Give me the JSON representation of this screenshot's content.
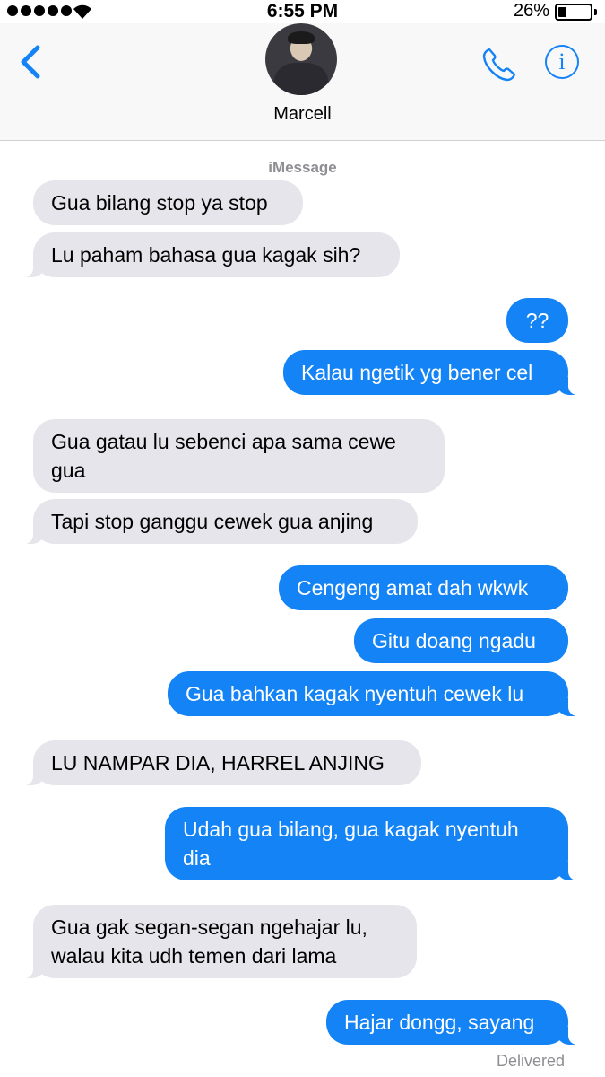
{
  "status_bar": {
    "time": "6:55 PM",
    "battery": "26%",
    "battery_level": 0.26,
    "signal_bars": 5,
    "icons": [
      "signal-dots",
      "wifi-icon",
      "battery-icon"
    ]
  },
  "header": {
    "contact_name": "Marcell",
    "icons": [
      "back-chevron-icon",
      "avatar",
      "phone-icon",
      "info-icon"
    ],
    "accent_color": "#1483f5"
  },
  "service_label": "iMessage",
  "colors": {
    "incoming_bubble": "#e6e5eb",
    "outgoing_bubble": "#1483f5",
    "meta_text": "#8e8e93"
  },
  "messages": [
    {
      "from": "contact",
      "text": "Gua bilang stop ya stop"
    },
    {
      "from": "contact",
      "text": "Lu paham bahasa gua kagak sih?"
    },
    {
      "from": "me",
      "text": "??"
    },
    {
      "from": "me",
      "text": "Kalau ngetik yg bener cel"
    },
    {
      "from": "contact",
      "text": "Gua gatau lu sebenci apa sama cewe gua"
    },
    {
      "from": "contact",
      "text": "Tapi stop ganggu cewek gua anjing"
    },
    {
      "from": "me",
      "text": "Cengeng amat dah wkwk"
    },
    {
      "from": "me",
      "text": "Gitu doang ngadu"
    },
    {
      "from": "me",
      "text": "Gua bahkan kagak nyentuh cewek lu"
    },
    {
      "from": "contact",
      "text": "LU NAMPAR DIA, HARREL ANJING"
    },
    {
      "from": "me",
      "text": "Udah gua bilang, gua kagak nyentuh dia"
    },
    {
      "from": "contact",
      "text": "Gua gak segan-segan ngehajar lu, walau kita udh temen dari lama"
    },
    {
      "from": "me",
      "text": "Hajar dongg, sayang"
    }
  ],
  "delivery_status": "Delivered"
}
